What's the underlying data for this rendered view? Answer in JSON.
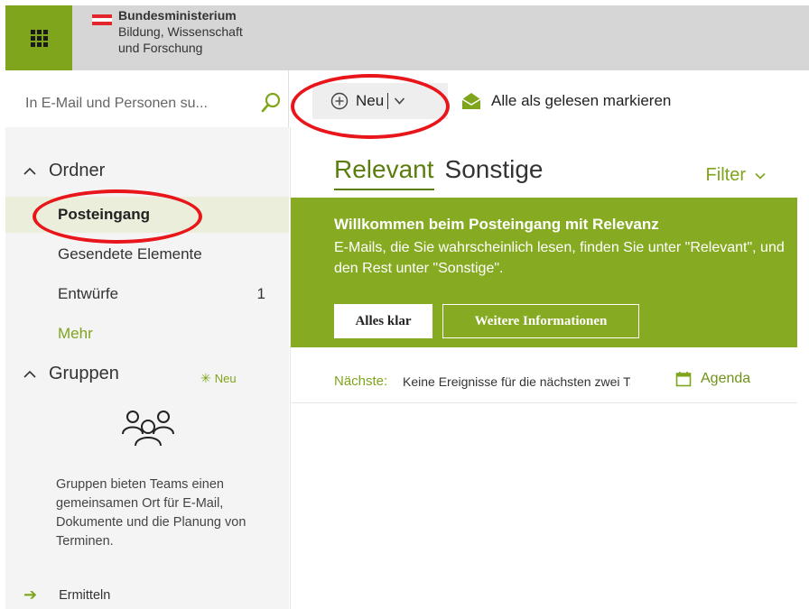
{
  "header": {
    "ministry_line1": "Bundesministerium",
    "ministry_line2": "Bildung, Wissenschaft",
    "ministry_line3": "und Forschung"
  },
  "search": {
    "placeholder": "In E-Mail und Personen su..."
  },
  "toolbar": {
    "new_label": "Neu",
    "mark_all_read_label": "Alle als gelesen markieren"
  },
  "sidebar": {
    "folders_heading": "Ordner",
    "folders": [
      {
        "label": "Posteingang",
        "selected": true
      },
      {
        "label": "Gesendete Elemente"
      },
      {
        "label": "Entwürfe",
        "count": "1"
      }
    ],
    "more_label": "Mehr",
    "groups_heading": "Gruppen",
    "groups_new_badge": "Neu",
    "groups_description": "Gruppen bieten Teams einen gemeinsamen Ort für E-Mail, Dokumente und die Planung von Terminen.",
    "discover_label": "Ermitteln"
  },
  "main": {
    "tabs": [
      {
        "label": "Relevant",
        "active": true
      },
      {
        "label": "Sonstige",
        "active": false
      }
    ],
    "filter_label": "Filter",
    "banner": {
      "title": "Willkommen beim Posteingang mit Relevanz",
      "body": "E-Mails, die Sie wahrscheinlich lesen, finden Sie unter \"Relevant\", und den Rest unter \"Sonstige\".",
      "ok_button": "Alles klar",
      "info_button": "Weitere Informationen"
    },
    "upcoming": {
      "label": "Nächste:",
      "text": "Keine Ereignisse für die nächsten zwei Tage",
      "agenda_label": "Agenda"
    }
  },
  "colors": {
    "accent_green": "#7ea51c",
    "banner_green": "#86ab22",
    "annotation_red": "#e8151b"
  }
}
